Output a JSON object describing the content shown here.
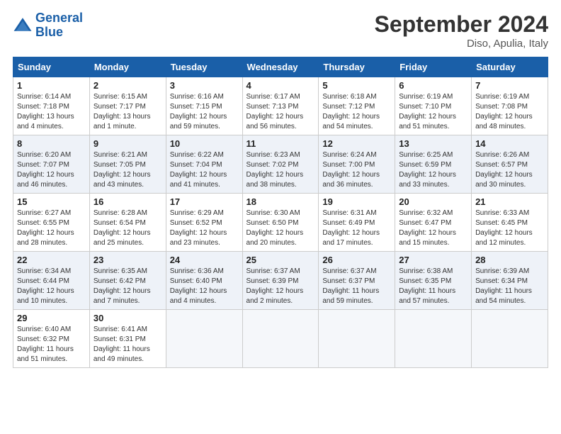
{
  "header": {
    "logo_line1": "General",
    "logo_line2": "Blue",
    "month": "September 2024",
    "location": "Diso, Apulia, Italy"
  },
  "weekdays": [
    "Sunday",
    "Monday",
    "Tuesday",
    "Wednesday",
    "Thursday",
    "Friday",
    "Saturday"
  ],
  "weeks": [
    [
      {
        "day": "1",
        "info": "Sunrise: 6:14 AM\nSunset: 7:18 PM\nDaylight: 13 hours\nand 4 minutes."
      },
      {
        "day": "2",
        "info": "Sunrise: 6:15 AM\nSunset: 7:17 PM\nDaylight: 13 hours\nand 1 minute."
      },
      {
        "day": "3",
        "info": "Sunrise: 6:16 AM\nSunset: 7:15 PM\nDaylight: 12 hours\nand 59 minutes."
      },
      {
        "day": "4",
        "info": "Sunrise: 6:17 AM\nSunset: 7:13 PM\nDaylight: 12 hours\nand 56 minutes."
      },
      {
        "day": "5",
        "info": "Sunrise: 6:18 AM\nSunset: 7:12 PM\nDaylight: 12 hours\nand 54 minutes."
      },
      {
        "day": "6",
        "info": "Sunrise: 6:19 AM\nSunset: 7:10 PM\nDaylight: 12 hours\nand 51 minutes."
      },
      {
        "day": "7",
        "info": "Sunrise: 6:19 AM\nSunset: 7:08 PM\nDaylight: 12 hours\nand 48 minutes."
      }
    ],
    [
      {
        "day": "8",
        "info": "Sunrise: 6:20 AM\nSunset: 7:07 PM\nDaylight: 12 hours\nand 46 minutes."
      },
      {
        "day": "9",
        "info": "Sunrise: 6:21 AM\nSunset: 7:05 PM\nDaylight: 12 hours\nand 43 minutes."
      },
      {
        "day": "10",
        "info": "Sunrise: 6:22 AM\nSunset: 7:04 PM\nDaylight: 12 hours\nand 41 minutes."
      },
      {
        "day": "11",
        "info": "Sunrise: 6:23 AM\nSunset: 7:02 PM\nDaylight: 12 hours\nand 38 minutes."
      },
      {
        "day": "12",
        "info": "Sunrise: 6:24 AM\nSunset: 7:00 PM\nDaylight: 12 hours\nand 36 minutes."
      },
      {
        "day": "13",
        "info": "Sunrise: 6:25 AM\nSunset: 6:59 PM\nDaylight: 12 hours\nand 33 minutes."
      },
      {
        "day": "14",
        "info": "Sunrise: 6:26 AM\nSunset: 6:57 PM\nDaylight: 12 hours\nand 30 minutes."
      }
    ],
    [
      {
        "day": "15",
        "info": "Sunrise: 6:27 AM\nSunset: 6:55 PM\nDaylight: 12 hours\nand 28 minutes."
      },
      {
        "day": "16",
        "info": "Sunrise: 6:28 AM\nSunset: 6:54 PM\nDaylight: 12 hours\nand 25 minutes."
      },
      {
        "day": "17",
        "info": "Sunrise: 6:29 AM\nSunset: 6:52 PM\nDaylight: 12 hours\nand 23 minutes."
      },
      {
        "day": "18",
        "info": "Sunrise: 6:30 AM\nSunset: 6:50 PM\nDaylight: 12 hours\nand 20 minutes."
      },
      {
        "day": "19",
        "info": "Sunrise: 6:31 AM\nSunset: 6:49 PM\nDaylight: 12 hours\nand 17 minutes."
      },
      {
        "day": "20",
        "info": "Sunrise: 6:32 AM\nSunset: 6:47 PM\nDaylight: 12 hours\nand 15 minutes."
      },
      {
        "day": "21",
        "info": "Sunrise: 6:33 AM\nSunset: 6:45 PM\nDaylight: 12 hours\nand 12 minutes."
      }
    ],
    [
      {
        "day": "22",
        "info": "Sunrise: 6:34 AM\nSunset: 6:44 PM\nDaylight: 12 hours\nand 10 minutes."
      },
      {
        "day": "23",
        "info": "Sunrise: 6:35 AM\nSunset: 6:42 PM\nDaylight: 12 hours\nand 7 minutes."
      },
      {
        "day": "24",
        "info": "Sunrise: 6:36 AM\nSunset: 6:40 PM\nDaylight: 12 hours\nand 4 minutes."
      },
      {
        "day": "25",
        "info": "Sunrise: 6:37 AM\nSunset: 6:39 PM\nDaylight: 12 hours\nand 2 minutes."
      },
      {
        "day": "26",
        "info": "Sunrise: 6:37 AM\nSunset: 6:37 PM\nDaylight: 11 hours\nand 59 minutes."
      },
      {
        "day": "27",
        "info": "Sunrise: 6:38 AM\nSunset: 6:35 PM\nDaylight: 11 hours\nand 57 minutes."
      },
      {
        "day": "28",
        "info": "Sunrise: 6:39 AM\nSunset: 6:34 PM\nDaylight: 11 hours\nand 54 minutes."
      }
    ],
    [
      {
        "day": "29",
        "info": "Sunrise: 6:40 AM\nSunset: 6:32 PM\nDaylight: 11 hours\nand 51 minutes."
      },
      {
        "day": "30",
        "info": "Sunrise: 6:41 AM\nSunset: 6:31 PM\nDaylight: 11 hours\nand 49 minutes."
      },
      {
        "day": "",
        "info": ""
      },
      {
        "day": "",
        "info": ""
      },
      {
        "day": "",
        "info": ""
      },
      {
        "day": "",
        "info": ""
      },
      {
        "day": "",
        "info": ""
      }
    ]
  ]
}
